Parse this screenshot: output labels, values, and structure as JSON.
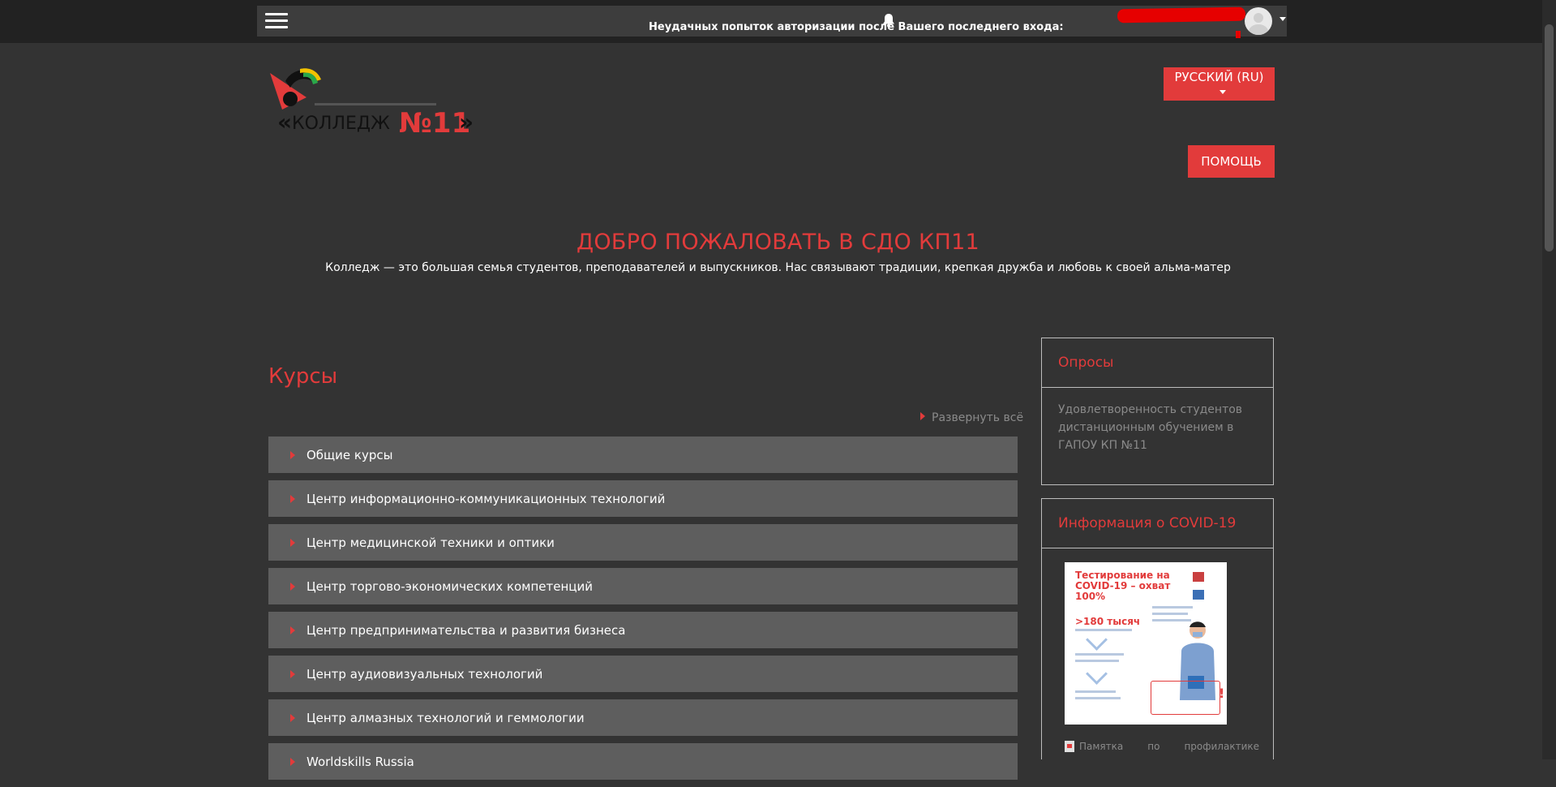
{
  "topbar": {
    "login_message": "Неудачных попыток авторизации после Вашего последнего входа:"
  },
  "header": {
    "logo_text": "«КОЛЛЕДЖ №11»",
    "language_button": "РУССКИЙ (RU)",
    "help_button": "ПОМОЩЬ"
  },
  "welcome": {
    "title": "ДОБРО ПОЖАЛОВАТЬ В СДО КП11",
    "subtitle": "Колледж — это большая семья студентов, преподавателей и выпускников. Нас связывают традиции, крепкая дружба и любовь к своей альма-матер"
  },
  "courses": {
    "title": "Курсы",
    "expand_all": "Развернуть всё",
    "categories": [
      "Общие курсы",
      "Центр информационно-коммуникационных технологий",
      "Центр медицинской техники и оптики",
      "Центр торгово-экономических компетенций",
      "Центр предпринимательства и развития бизнеса",
      "Центр аудиовизуальных технологий",
      "Центр алмазных технологий и геммологии",
      "Worldskills Russia"
    ]
  },
  "sidebar": {
    "surveys": {
      "title": "Опросы",
      "link": "Удовлетворенность студентов дистанционным обучением в ГАПОУ КП №11"
    },
    "covid": {
      "title": "Информация о COVID-19",
      "poster_title": "Тестирование на COVID-19 – охват 100%",
      "poster_stat": ">180 тысяч",
      "memo_words": [
        "Памятка",
        "по",
        "профилактике"
      ]
    }
  },
  "colors": {
    "accent": "#e23b3b",
    "background": "#333333",
    "topbar": "#222222",
    "category_bg": "#5e5e5e",
    "muted_text": "#8a8a8a"
  }
}
